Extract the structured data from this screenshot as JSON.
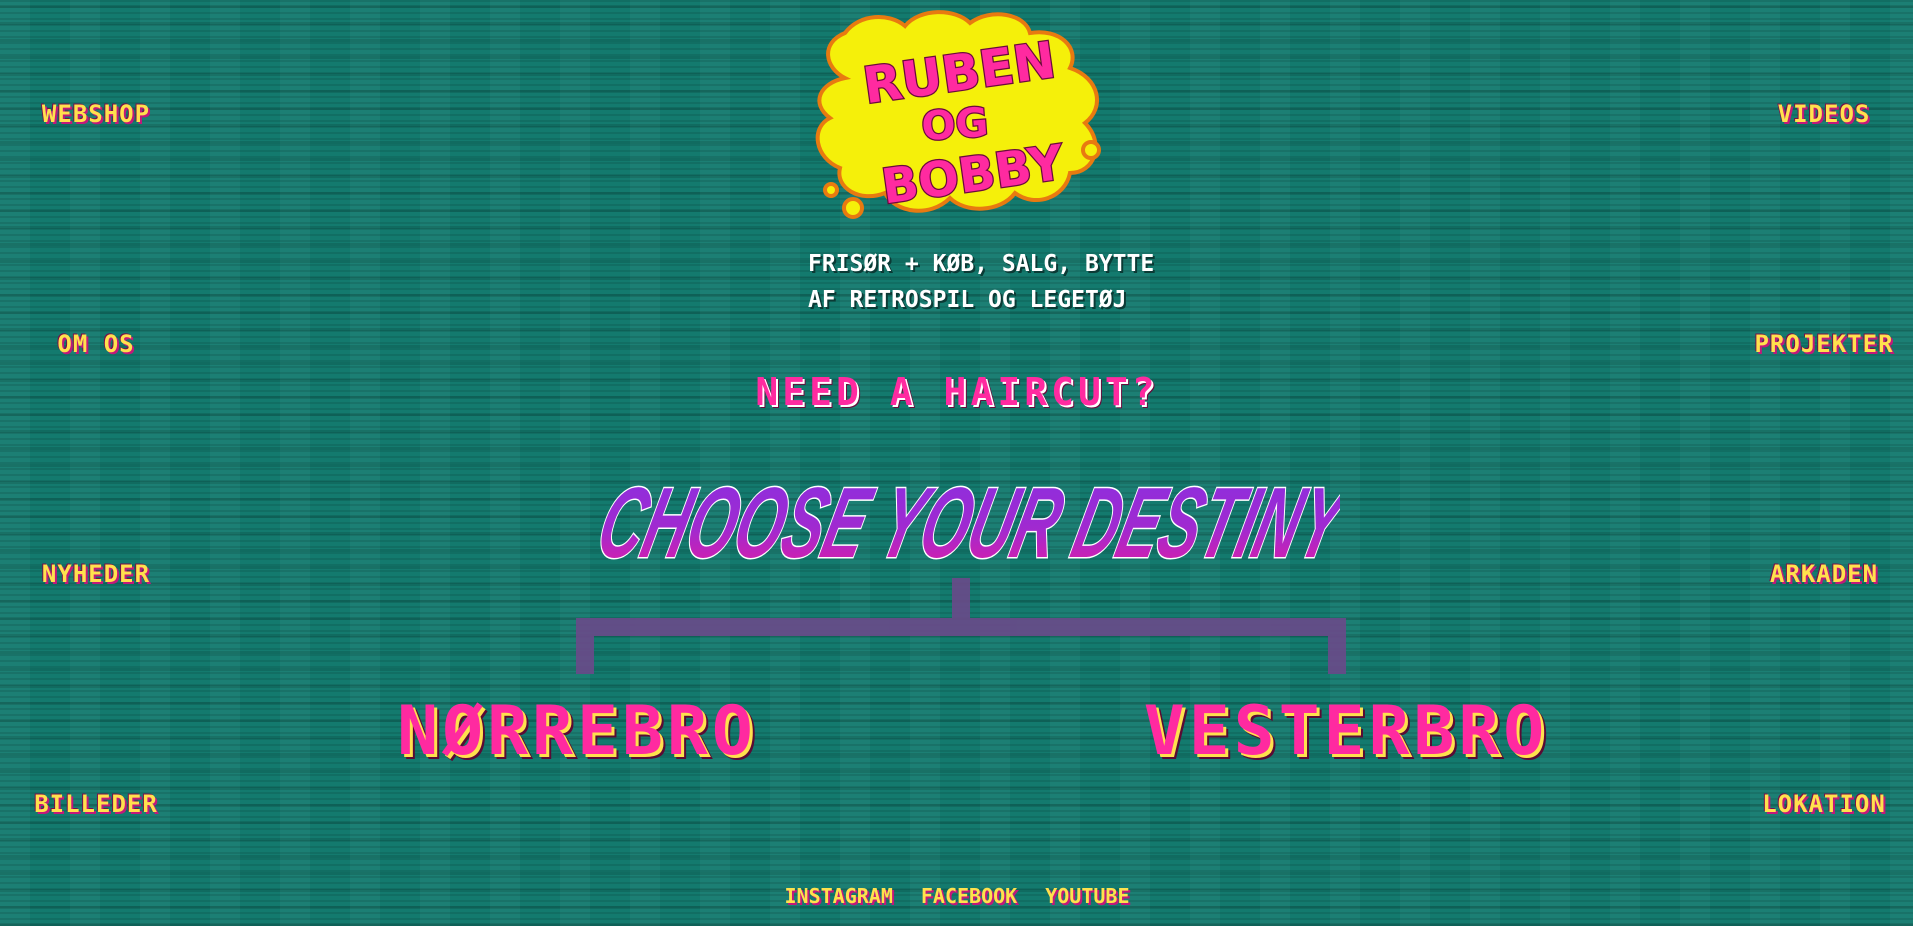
{
  "logo": {
    "line1": "RUBEN",
    "line2": "OG",
    "line3": "BOBBY",
    "icon": "cloud-logo-icon"
  },
  "tagline": {
    "line1": "FRISØR + KØB, SALG, BYTTE",
    "line2": "AF RETROSPIL OG LEGETØJ"
  },
  "prompt": "NEED A HAIRCUT?",
  "headline": "CHOOSE YOUR DESTINY",
  "nav_left": [
    "WEBSHOP",
    "OM OS",
    "NYHEDER",
    "BILLEDER"
  ],
  "nav_right": [
    "VIDEOS",
    "PROJEKTER",
    "ARKADEN",
    "LOKATION"
  ],
  "locations": [
    "NØRREBRO",
    "VESTERBRO"
  ],
  "social": [
    "INSTAGRAM",
    "FACEBOOK",
    "YOUTUBE"
  ],
  "colors": {
    "background": "#137a6e",
    "nav_text": "#ffe14d",
    "accent_pink": "#ff2aa0",
    "accent_purple": "#7a2fd0",
    "logo_yellow": "#f5f00a",
    "logo_outline": "#e87a10",
    "bracket": "#6a4a8a"
  }
}
